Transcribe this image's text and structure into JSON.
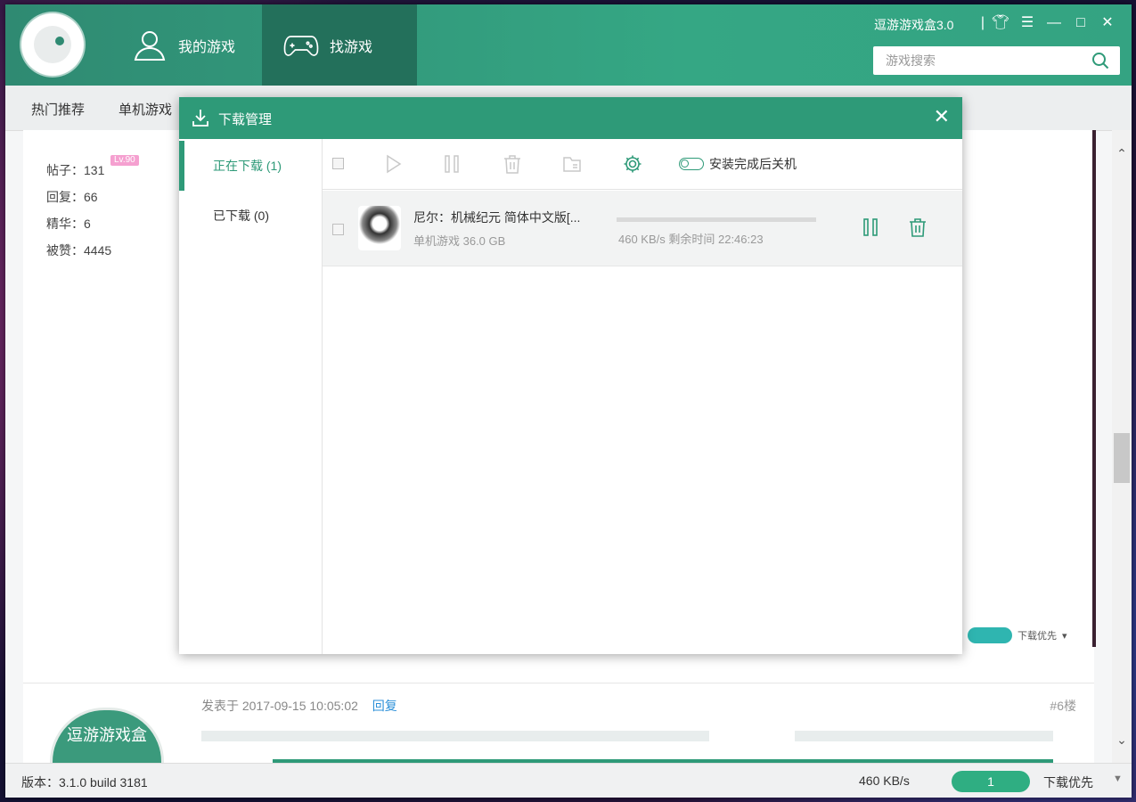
{
  "app": {
    "brand": "逗游游戏盒3.0",
    "nav": [
      {
        "label": "我的游戏"
      },
      {
        "label": "找游戏"
      }
    ],
    "search_placeholder": "游戏搜索",
    "categories": [
      "热门推荐",
      "单机游戏"
    ]
  },
  "background_page": {
    "level_badge": "Lv.90",
    "stats": [
      "帖子：131",
      "回复：66",
      "精华：6",
      "被赞：4445"
    ],
    "post_meta": "发表于 2017-09-15 10:05:02",
    "reply_link": "回复",
    "floor": "#6楼",
    "avatar_text": "逗游游戏盒",
    "mini_download_label": "下载优先"
  },
  "modal": {
    "title": "下载管理",
    "tabs": [
      {
        "label": "正在下载 (1)",
        "active": true
      },
      {
        "label": "已下载 (0)",
        "active": false
      }
    ],
    "toolbar": {
      "shutdown_toggle_label": "安装完成后关机",
      "shutdown_enabled": false
    },
    "downloads": [
      {
        "title": "尼尔：机械纪元  简体中文版[...",
        "category_size": "单机游戏  36.0 GB",
        "progress": 0.0,
        "speed_remaining": "460 KB/s 剩余时间 22:46:23"
      }
    ]
  },
  "footer": {
    "version": "版本：3.1.0 build 3181",
    "speed": "460 KB/s",
    "task_count": "1",
    "priority": "下载优先"
  },
  "colors": {
    "accent": "#2e9a78",
    "header": "#35a784",
    "link": "#2b8fd8"
  }
}
